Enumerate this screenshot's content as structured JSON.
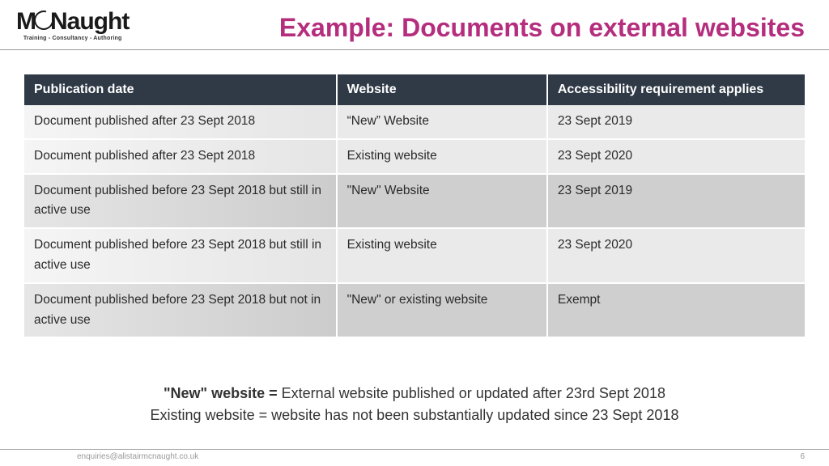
{
  "logo": {
    "left": "M",
    "right": "Naught",
    "sub": "Training - Consultancy - Authoring"
  },
  "title": "Example: Documents on external websites",
  "table": {
    "headers": [
      "Publication date",
      "Website",
      "Accessibility requirement applies"
    ],
    "rows": [
      {
        "shade": "light",
        "cells": [
          "Document published after 23 Sept 2018",
          "“New” Website",
          "23 Sept 2019"
        ]
      },
      {
        "shade": "light",
        "cells": [
          "Document published after 23 Sept 2018",
          "Existing website",
          "23 Sept 2020"
        ]
      },
      {
        "shade": "dark",
        "cells": [
          "Document published before 23 Sept 2018 but still in active use",
          "\"New\" Website",
          "23 Sept 2019"
        ]
      },
      {
        "shade": "light",
        "cells": [
          "Document published before 23 Sept 2018 but still in active use",
          "Existing website",
          "23 Sept 2020"
        ]
      },
      {
        "shade": "dark",
        "cells": [
          "Document published before 23 Sept 2018 but not in active use",
          "\"New\" or existing website",
          "Exempt"
        ]
      }
    ]
  },
  "definitions": {
    "label1": "\"New\" website = ",
    "text1": "External website published or updated after 23rd Sept 2018",
    "text2": "Existing website = website has not been substantially updated since 23 Sept 2018"
  },
  "footer": {
    "email": "enquiries@alistairmcnaught.co.uk",
    "page": "6"
  }
}
